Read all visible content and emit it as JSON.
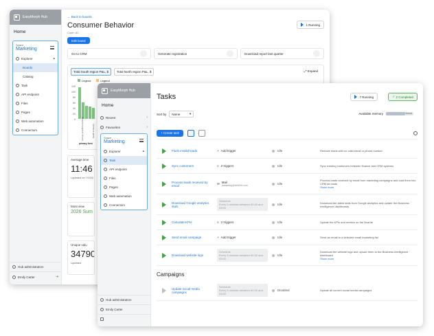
{
  "app": {
    "brand": "EasyMorph Hub"
  },
  "back": {
    "sidebar": {
      "home": "Home",
      "space_label": "Space",
      "space_name": "Marketing",
      "items": [
        {
          "label": "Explorer"
        },
        {
          "label": "Boards"
        },
        {
          "label": "Catalog"
        },
        {
          "label": "Task"
        },
        {
          "label": "API endpoint"
        },
        {
          "label": "Files"
        },
        {
          "label": "Pages"
        },
        {
          "label": "Web automation"
        },
        {
          "label": "Connectors"
        }
      ],
      "hub_admin": "Hub administration",
      "user": "Emily Carter"
    },
    "back_link": "Back to boards",
    "title": "Consumer Behavior",
    "code": "Code: A1",
    "edit_board": "Edit board",
    "running": "1 Running",
    "actions": [
      "Go to CRM",
      "Generate registration",
      "Download report last quarter"
    ],
    "tabs": [
      "Total South region P&L, $",
      "Total North region P&L, $"
    ],
    "expand": "Expand",
    "legend": [
      "Legend",
      "Legend"
    ],
    "chart_yticks": [
      "120",
      "100",
      "80",
      "60",
      "40",
      "20",
      "0"
    ],
    "chart_xlabels": [
      "primary & fulfill furnishings",
      "health & beauty"
    ],
    "chart_xtitle": "primary furni",
    "cards": [
      {
        "label": "Average time",
        "big": "11:46",
        "small": "Updated on 7/29/2"
      },
      {
        "label": "Most view",
        "green": "2026 Sum sale"
      },
      {
        "label": "Unique valu",
        "big": "34790",
        "small": "Updated"
      }
    ]
  },
  "front": {
    "sidebar": {
      "home": "Home",
      "items_top": [
        {
          "label": "Recent"
        },
        {
          "label": "Favourites"
        }
      ],
      "space_label": "Space",
      "space_name": "Marketing",
      "items": [
        {
          "label": "Explorer"
        },
        {
          "label": "Task"
        },
        {
          "label": "API endpoint"
        },
        {
          "label": "Files"
        },
        {
          "label": "Pages"
        },
        {
          "label": "Web automation"
        },
        {
          "label": "Connectors"
        }
      ],
      "hub_admin": "Hub administration",
      "user": "Emily Carter"
    },
    "title": "Tasks",
    "running": "7 Running",
    "completed": "2 Completed",
    "sort_by": "Sort by",
    "sort_value": "Name",
    "available_memory": "Available memory",
    "memory_value": "500GB",
    "memory_fraction": 0.7,
    "create_task": "Create task",
    "tasks": [
      {
        "name": "Flush invalid leads",
        "trigger": "Add trigger",
        "status": "Idle",
        "desc": "Remove leads with no valid email or phone number"
      },
      {
        "name": "Sync customers",
        "trigger": "2 triggers",
        "status": "Idle",
        "desc": "Sync existing customers between finance and CRM systems"
      },
      {
        "name": "Process leads received by email",
        "trigger": "Mail",
        "trigger_sub": "marketing@hb0000.com",
        "status": "Idle",
        "desc": "Process leads received by email from marketing campaigns and load them into CRM as leads",
        "more": "Show more"
      },
      {
        "name": "Download Google analytics stats",
        "trigger": "Schedule",
        "trigger_sub": "Every 5 minutes between 00:00 and 03:00",
        "status": "Idle",
        "desc": "Download the latest stats from Google analytics and update the Business Intelligence dashboards"
      },
      {
        "name": "Calculate KPIs",
        "trigger": "2 triggers",
        "status": "Idle",
        "desc": "Update the KPIs and metrics on the Boards"
      },
      {
        "name": "Send email campaign",
        "trigger": "Add trigger",
        "status": "Idle",
        "desc": "Send an email to a selected email marketing list"
      },
      {
        "name": "Download website logs",
        "trigger": "Schedule",
        "trigger_sub": "Every 5 minutes between 00:00 and 03:00",
        "status": "Idle",
        "desc": "Download the website logs and upload them to the Business Intelligence dashboard",
        "more": "Show more"
      }
    ],
    "campaigns_title": "Campaigns",
    "campaigns": [
      {
        "name": "Update social media campaigns",
        "trigger": "Schedule",
        "trigger_sub": "Every 5 minutes between 00:00 and 03:00",
        "status": "Disabled",
        "desc": "Update all current social media campaigns"
      }
    ]
  }
}
